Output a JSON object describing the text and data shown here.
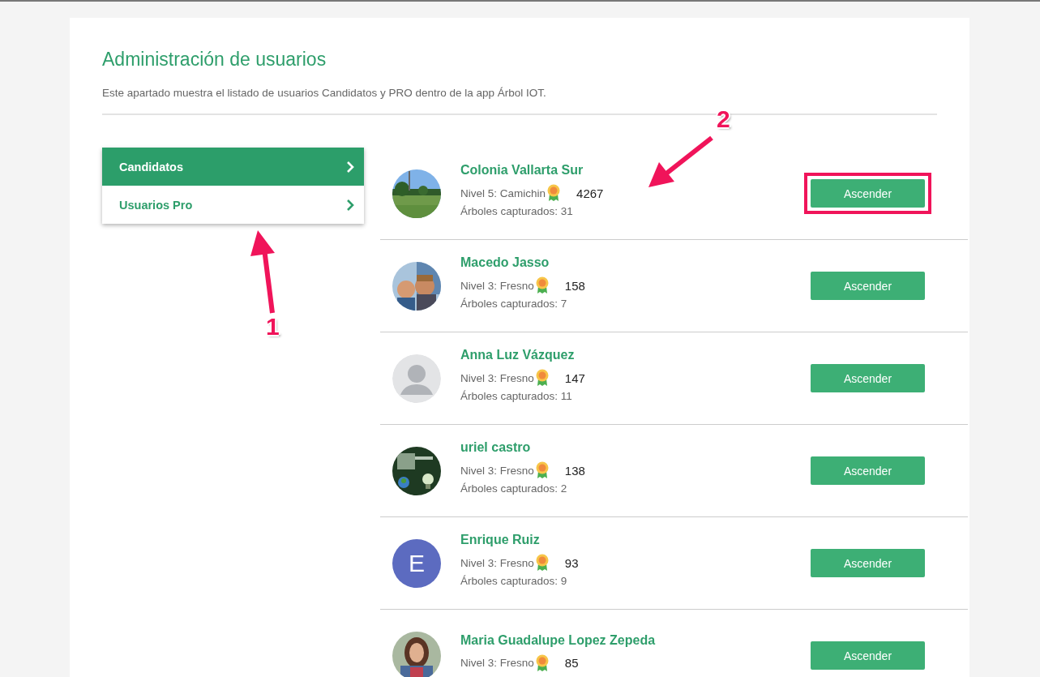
{
  "page": {
    "title": "Administración de usuarios",
    "description": "Este apartado muestra el listado de usuarios Candidatos y PRO dentro de la app Árbol IOT."
  },
  "sidebar": {
    "items": [
      {
        "label": "Candidatos",
        "selected": true
      },
      {
        "label": "Usuarios Pro",
        "selected": false
      }
    ]
  },
  "users": [
    {
      "name": "Colonia Vallarta Sur",
      "level": "Nivel 5: Camichin",
      "points": "4267",
      "trees": "Árboles capturados: 31",
      "button": "Ascender",
      "highlighted": true
    },
    {
      "name": "Macedo Jasso",
      "level": "Nivel 3: Fresno",
      "points": "158",
      "trees": "Árboles capturados: 7",
      "button": "Ascender",
      "highlighted": false
    },
    {
      "name": "Anna Luz Vázquez",
      "level": "Nivel 3: Fresno",
      "points": "147",
      "trees": "Árboles capturados: 11",
      "avatar": {
        "kind": "placeholder"
      },
      "button": "Ascender",
      "highlighted": false
    },
    {
      "name": "uriel castro",
      "level": "Nivel 3: Fresno",
      "points": "138",
      "trees": "Árboles capturados: 2",
      "button": "Ascender",
      "highlighted": false
    },
    {
      "name": "Enrique Ruiz",
      "level": "Nivel 3: Fresno",
      "points": "93",
      "trees": "Árboles capturados: 9",
      "avatar": {
        "kind": "letter",
        "letter": "E",
        "color": "#5c6bc0"
      },
      "button": "Ascender",
      "highlighted": false
    },
    {
      "name": "Maria Guadalupe Lopez Zepeda",
      "level": "Nivel 3: Fresno",
      "points": "85",
      "button": "Ascender",
      "highlighted": false
    }
  ],
  "annotations": [
    {
      "label": "1"
    },
    {
      "label": "2"
    }
  ]
}
